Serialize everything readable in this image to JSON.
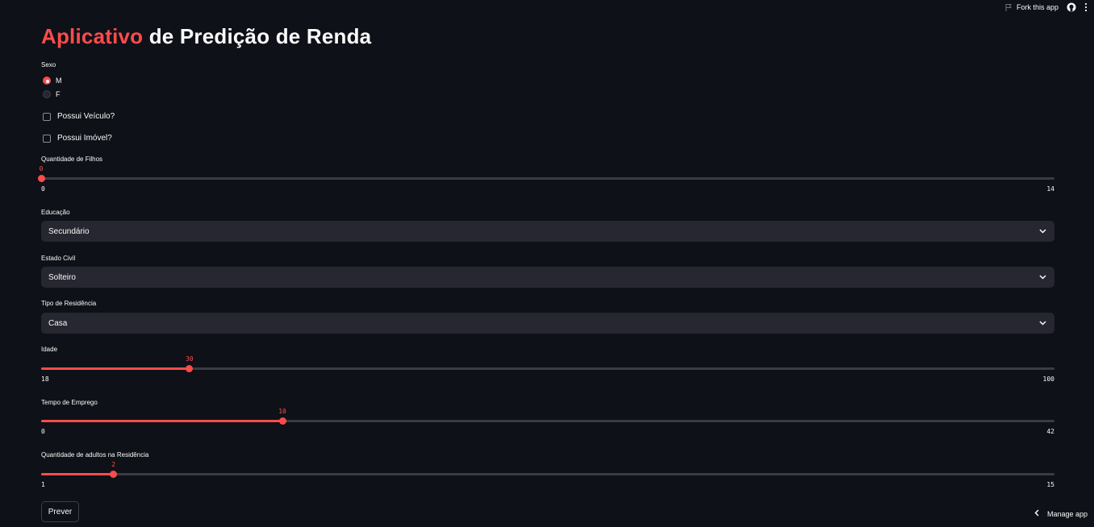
{
  "toolbar": {
    "fork_label": "Fork this app"
  },
  "title": {
    "accent": "Aplicativo",
    "rest": "de Predição de Renda"
  },
  "sexo": {
    "label": "Sexo",
    "options": [
      "M",
      "F"
    ],
    "selected": "M"
  },
  "veiculo": {
    "label": "Possui Veículo?",
    "checked": false
  },
  "imovel": {
    "label": "Possui Imóvel?",
    "checked": false
  },
  "filhos": {
    "label": "Quantidade de Filhos",
    "min": 0,
    "max": 14,
    "value": 0,
    "min_text": "0",
    "max_text": "14",
    "value_text": "0"
  },
  "educacao": {
    "label": "Educação",
    "value": "Secundário"
  },
  "estado_civil": {
    "label": "Estado Civil",
    "value": "Solteiro"
  },
  "residencia": {
    "label": "Tipo de Residência",
    "value": "Casa"
  },
  "idade": {
    "label": "Idade",
    "min": 18,
    "max": 100,
    "value": 30,
    "min_text": "18",
    "max_text": "100",
    "value_text": "30"
  },
  "emprego": {
    "label": "Tempo de Emprego",
    "min": 0,
    "max": 42,
    "value": 10,
    "min_text": "0",
    "max_text": "42",
    "value_text": "10"
  },
  "adultos": {
    "label": "Quantidade de adultos na Residência",
    "min": 1,
    "max": 15,
    "value": 2,
    "min_text": "1",
    "max_text": "15",
    "value_text": "2"
  },
  "button": {
    "label": "Prever"
  },
  "manage": {
    "label": "Manage app"
  },
  "colors": {
    "accent": "#ff4b4b",
    "background": "#0e1117",
    "widget": "#262730"
  }
}
